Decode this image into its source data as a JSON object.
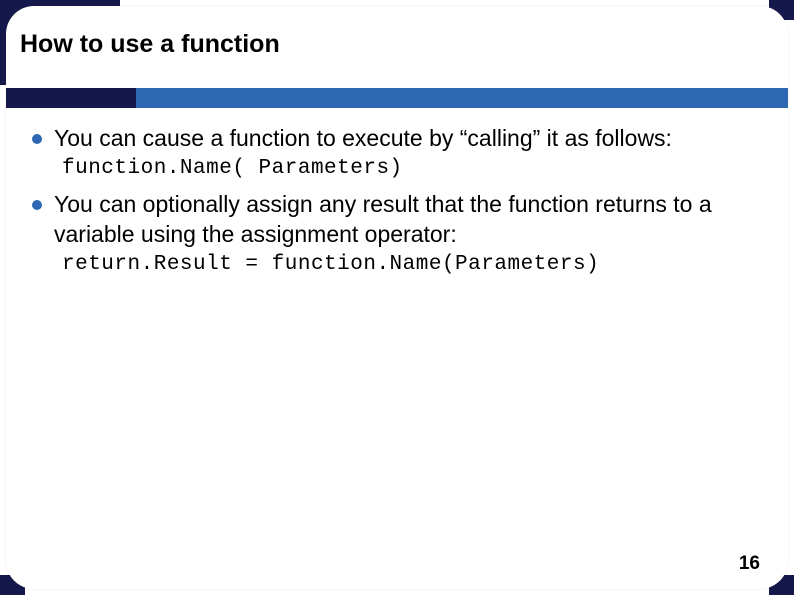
{
  "title": "How to use a function",
  "bullets": [
    {
      "text": "You can cause a function to execute by “calling” it as follows:",
      "code": "function.Name( Parameters)"
    },
    {
      "text": "You can optionally assign any result that the function returns to a variable using the assignment operator:",
      "code": "return.Result = function.Name(Parameters)"
    }
  ],
  "page_number": "16"
}
